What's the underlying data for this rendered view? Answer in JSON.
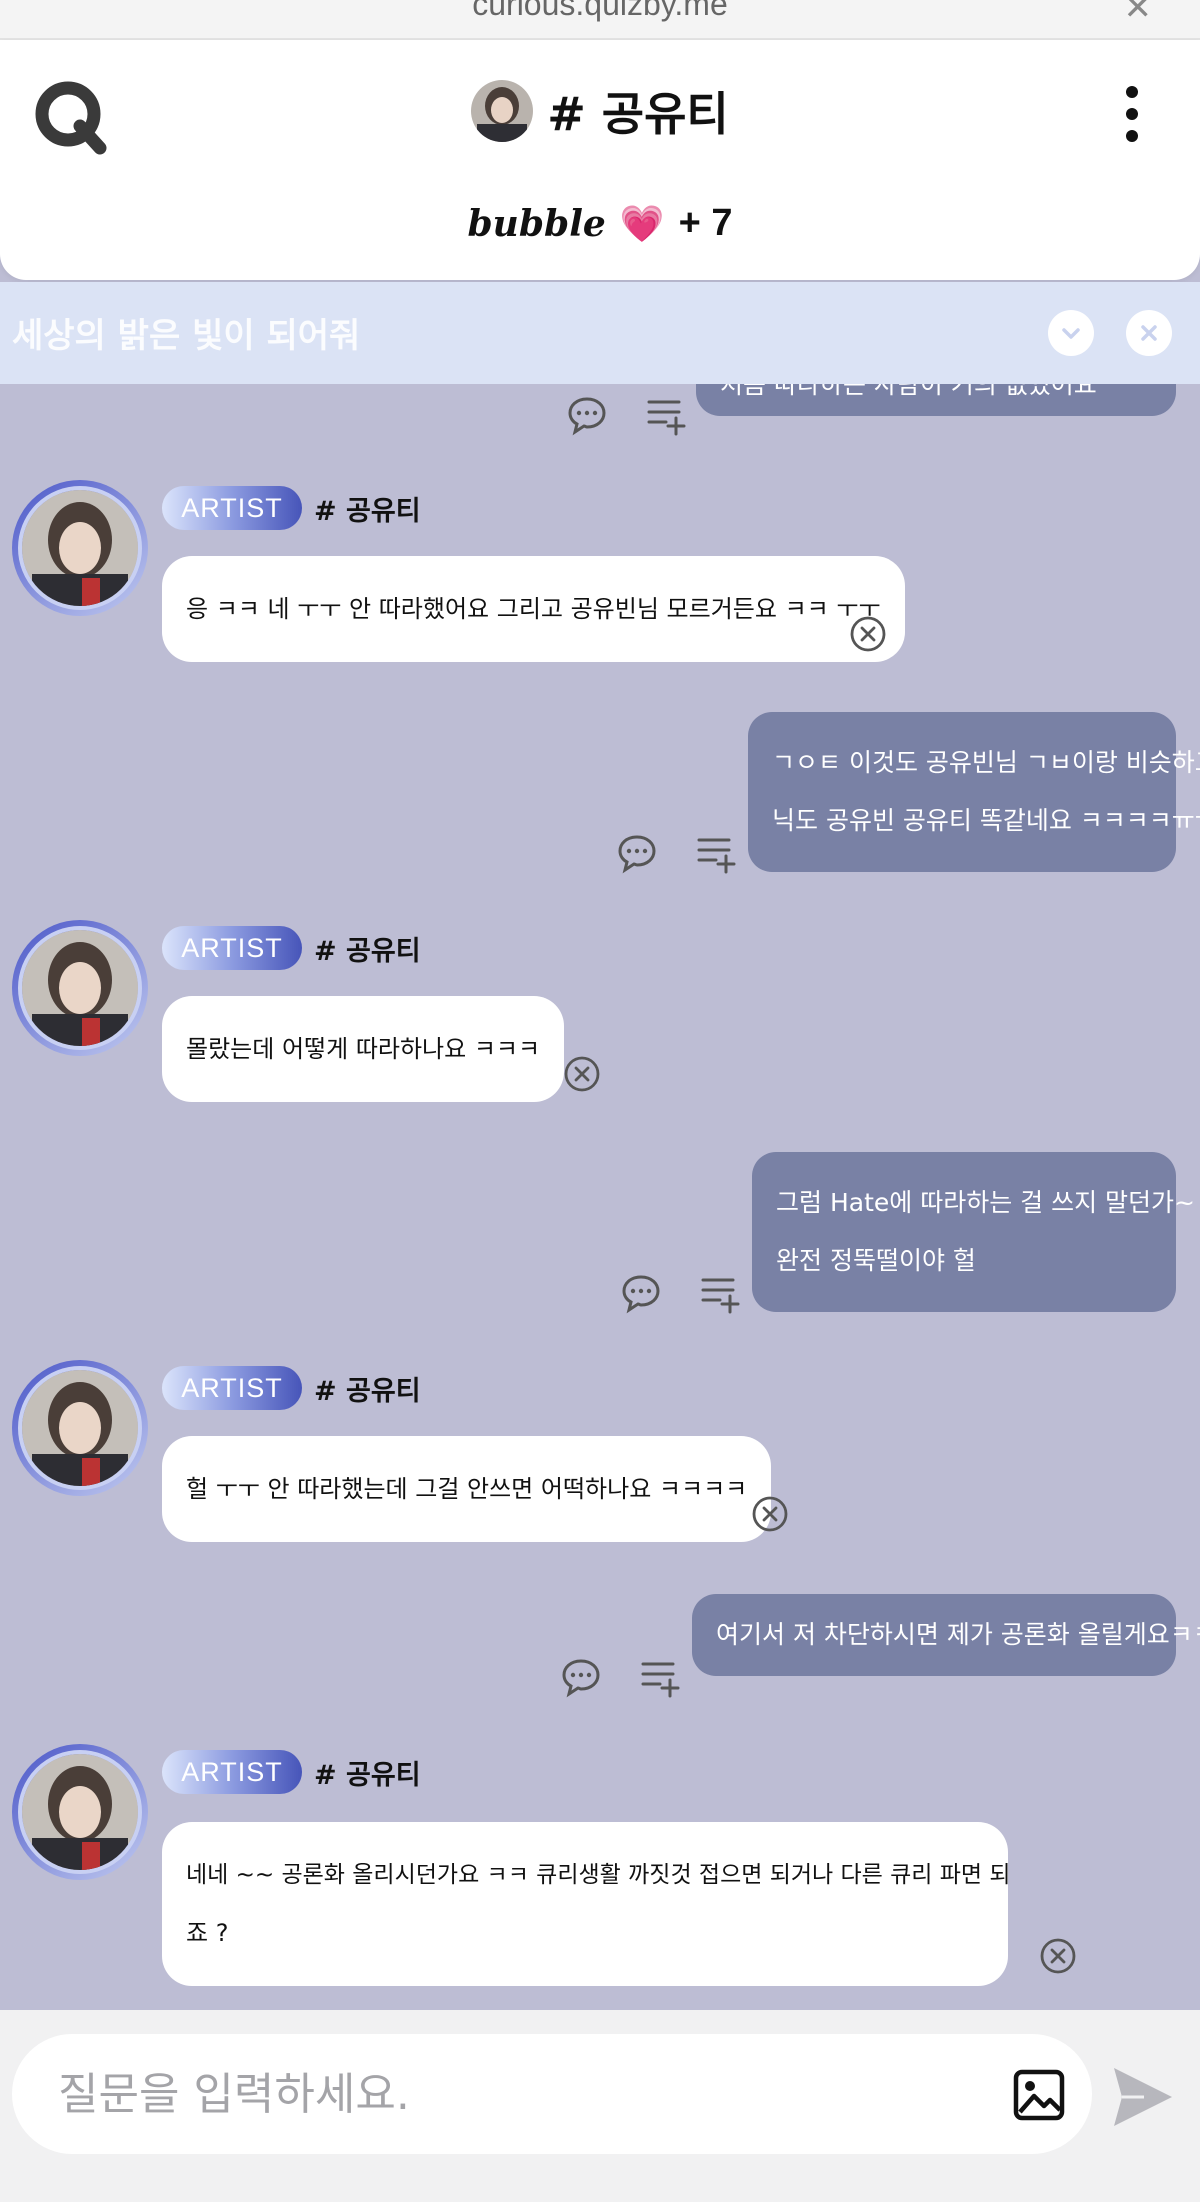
{
  "browser": {
    "url": "curious.quizby.me",
    "close_glyph": "✕"
  },
  "header": {
    "channel_title": "# 공유티",
    "subtitle": {
      "bubble": "bubble",
      "heart": "💗",
      "plus": "+ 7"
    }
  },
  "banner": {
    "text": "세상의 밝은 빛이 되어줘"
  },
  "chat": {
    "messages": [
      {
        "type": "fan",
        "lines": [
          "처음 따라하는 사람이 거의 없었어요"
        ]
      },
      {
        "type": "artist",
        "badge": "ARTIST",
        "name": "# 공유티",
        "lines": [
          "응 ㅋㅋ 네 ㅜㅜ 안 따라했어요 그리고 공유빈님 모르거든요 ㅋㅋ ㅜㅜ"
        ]
      },
      {
        "type": "fan",
        "lines": [
          "ㄱㅇㅌ 이것도 공유빈님 ㄱㅂ이랑 비슷하고",
          "닉도 공유빈 공유티 똑같네요 ㅋㅋㅋㅋㅠㅠㅋ"
        ]
      },
      {
        "type": "artist",
        "badge": "ARTIST",
        "name": "# 공유티",
        "lines": [
          "몰랐는데 어떻게 따라하나요 ㅋㅋㅋ"
        ]
      },
      {
        "type": "fan",
        "lines": [
          "그럼 Hate에 따라하는 걸 쓰지 말던가~",
          "완전 정뚝떨이야 헐"
        ]
      },
      {
        "type": "artist",
        "badge": "ARTIST",
        "name": "# 공유티",
        "lines": [
          "헐 ㅜㅜ 안 따라했는데 그걸 안쓰면 어떡하나요 ㅋㅋㅋㅋ"
        ]
      },
      {
        "type": "fan",
        "lines": [
          "여기서 저 차단하시면 제가 공론화 올릴게요ㅋㅋ"
        ]
      },
      {
        "type": "artist",
        "badge": "ARTIST",
        "name": "# 공유티",
        "lines": [
          "네네 ~~ 공론화 올리시던가요 ㅋㅋ 큐리생활 까짓것 접으면 되거나 다른 큐리 파면 되",
          "죠 ?"
        ]
      }
    ]
  },
  "input": {
    "placeholder": "질문을 입력하세요."
  },
  "colors": {
    "fan_bubble": "#7981a5",
    "chat_bg": "#bdbdd4",
    "banner_bg": "#dbe3f5",
    "artist_bubble": "#ffffff"
  }
}
